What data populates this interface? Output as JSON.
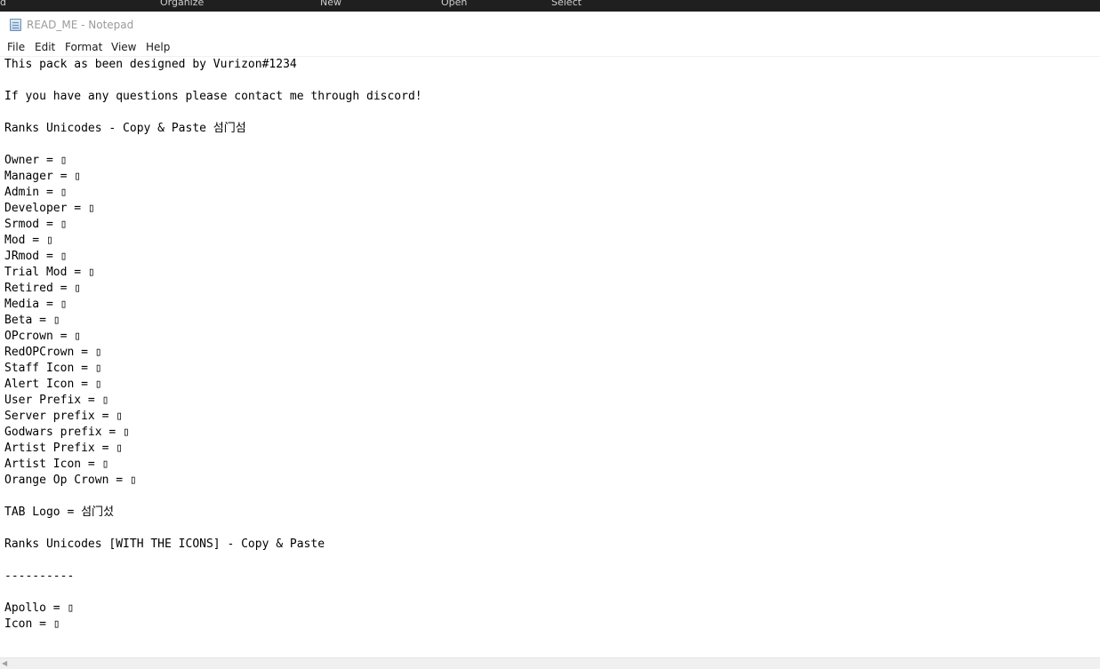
{
  "top_strip": {
    "items": [
      {
        "label": "d"
      },
      {
        "label": "Organize"
      },
      {
        "label": "New"
      },
      {
        "label": "Open"
      },
      {
        "label": "Select"
      }
    ]
  },
  "window": {
    "title": "READ_ME - Notepad",
    "app_icon": "notepad-icon"
  },
  "menu": {
    "items": [
      {
        "label": "File"
      },
      {
        "label": "Edit"
      },
      {
        "label": "Format"
      },
      {
        "label": "View"
      },
      {
        "label": "Help"
      }
    ]
  },
  "document": {
    "lines": [
      "This pack as been designed by Vurizon#1234",
      "",
      "If you have any questions please contact me through discord!",
      "",
      "Ranks Unicodes - Copy & Paste 섬门섬",
      "",
      "Owner = ▯",
      "Manager = ▯",
      "Admin = ▯",
      "Developer = ▯",
      "Srmod = ▯",
      "Mod = ▯",
      "JRmod = ▯",
      "Trial Mod = ▯",
      "Retired = ▯",
      "Media = ▯",
      "Beta = ▯",
      "OPcrown = ▯",
      "RedOPCrown = ▯",
      "Staff Icon = ▯",
      "Alert Icon = ▯",
      "User Prefix = ▯",
      "Server prefix = ▯",
      "Godwars prefix = ▯",
      "Artist Prefix = ▯",
      "Artist Icon = ▯",
      "Orange Op Crown = ▯",
      "",
      "TAB Logo = 섬门섰",
      "",
      "Ranks Unicodes [WITH THE ICONS] - Copy & Paste",
      "",
      "----------",
      "",
      "Apollo = ▯",
      "Icon = ▯"
    ]
  }
}
